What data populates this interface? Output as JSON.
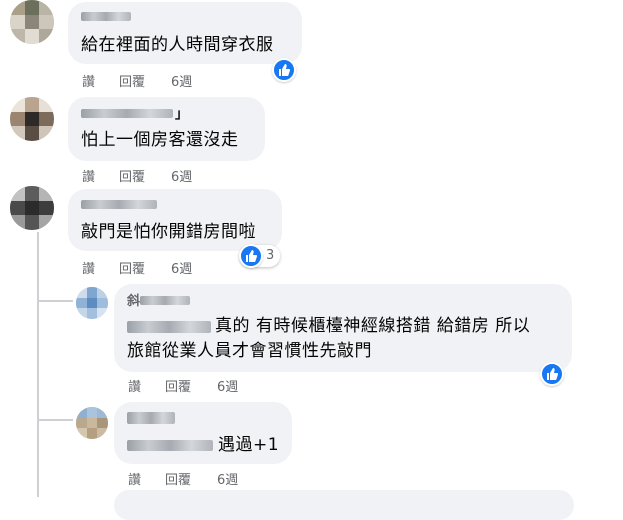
{
  "comments": [
    {
      "text": "給在裡面的人時間穿衣服",
      "like": "讚",
      "reply": "回覆",
      "time": "6週"
    },
    {
      "name_suffix": "」",
      "text": "怕上一個房客還沒走",
      "like": "讚",
      "reply": "回覆",
      "time": "6週"
    },
    {
      "text": "敲門是怕你開錯房間啦",
      "like": "讚",
      "reply": "回覆",
      "time": "6週",
      "reaction_count": "3"
    },
    {
      "name_visible": "斜",
      "line1": "真的 有時候櫃檯神經線搭錯 給錯房 所以",
      "line2": "旅館從業人員才會習慣性先敲門",
      "like": "讚",
      "reply": "回覆",
      "time": "6週"
    },
    {
      "text": "遇過+1",
      "like": "讚",
      "reply": "回覆",
      "time": "6週"
    }
  ],
  "icons": {
    "reaction": "thumbs-up-icon"
  },
  "colors": {
    "accent": "#1877f2",
    "bubble": "#f0f2f5",
    "meta": "#65676b"
  }
}
